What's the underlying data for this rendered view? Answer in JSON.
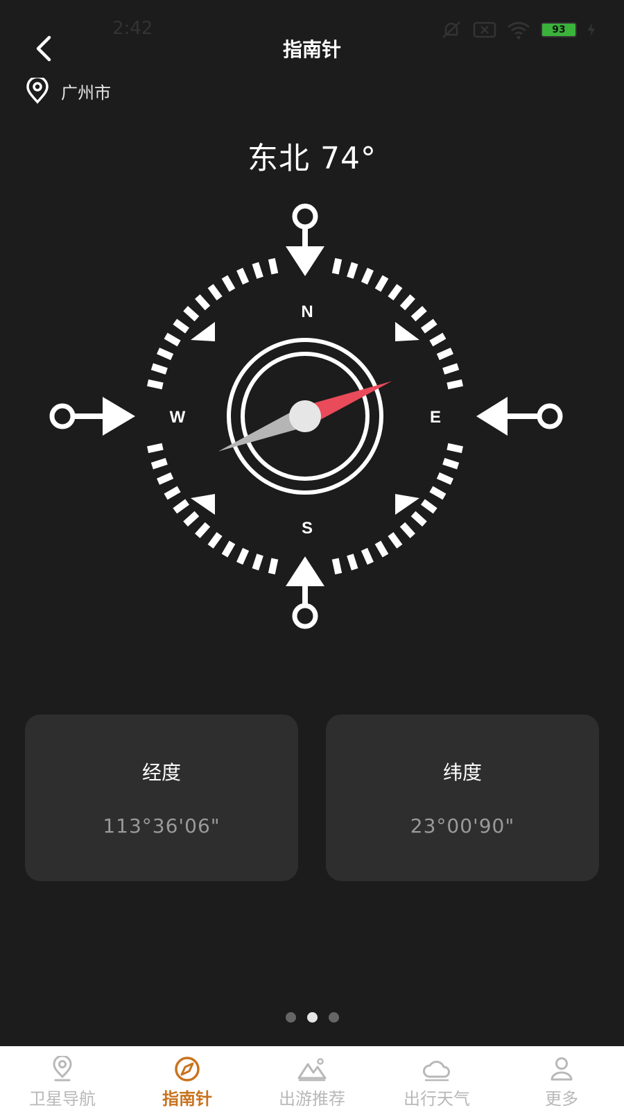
{
  "status_bar": {
    "time": "2:42",
    "battery": "93"
  },
  "header": {
    "title": "指南针"
  },
  "location": {
    "city": "广州市"
  },
  "heading": {
    "direction": "东北",
    "degrees": "74°"
  },
  "compass": {
    "heading_degrees": 74,
    "labels": {
      "north": "N",
      "east": "E",
      "south": "S",
      "west": "W"
    },
    "colors": {
      "needle_red": "#e94b5b",
      "needle_gray": "#b5b5b5"
    }
  },
  "coords": {
    "longitude": {
      "label": "经度",
      "value": "113°36'06\""
    },
    "latitude": {
      "label": "纬度",
      "value": "23°00'90\""
    }
  },
  "pager": {
    "count": 3,
    "active_index": 1
  },
  "tabs": [
    {
      "label": "卫星导航",
      "icon": "location-pin-icon"
    },
    {
      "label": "指南针",
      "icon": "compass-icon"
    },
    {
      "label": "出游推荐",
      "icon": "mountain-icon"
    },
    {
      "label": "出行天气",
      "icon": "cloud-icon"
    },
    {
      "label": "更多",
      "icon": "user-icon"
    }
  ],
  "colors": {
    "accent": "#c8731e",
    "background": "#1c1c1c",
    "card": "#2e2e2e"
  }
}
